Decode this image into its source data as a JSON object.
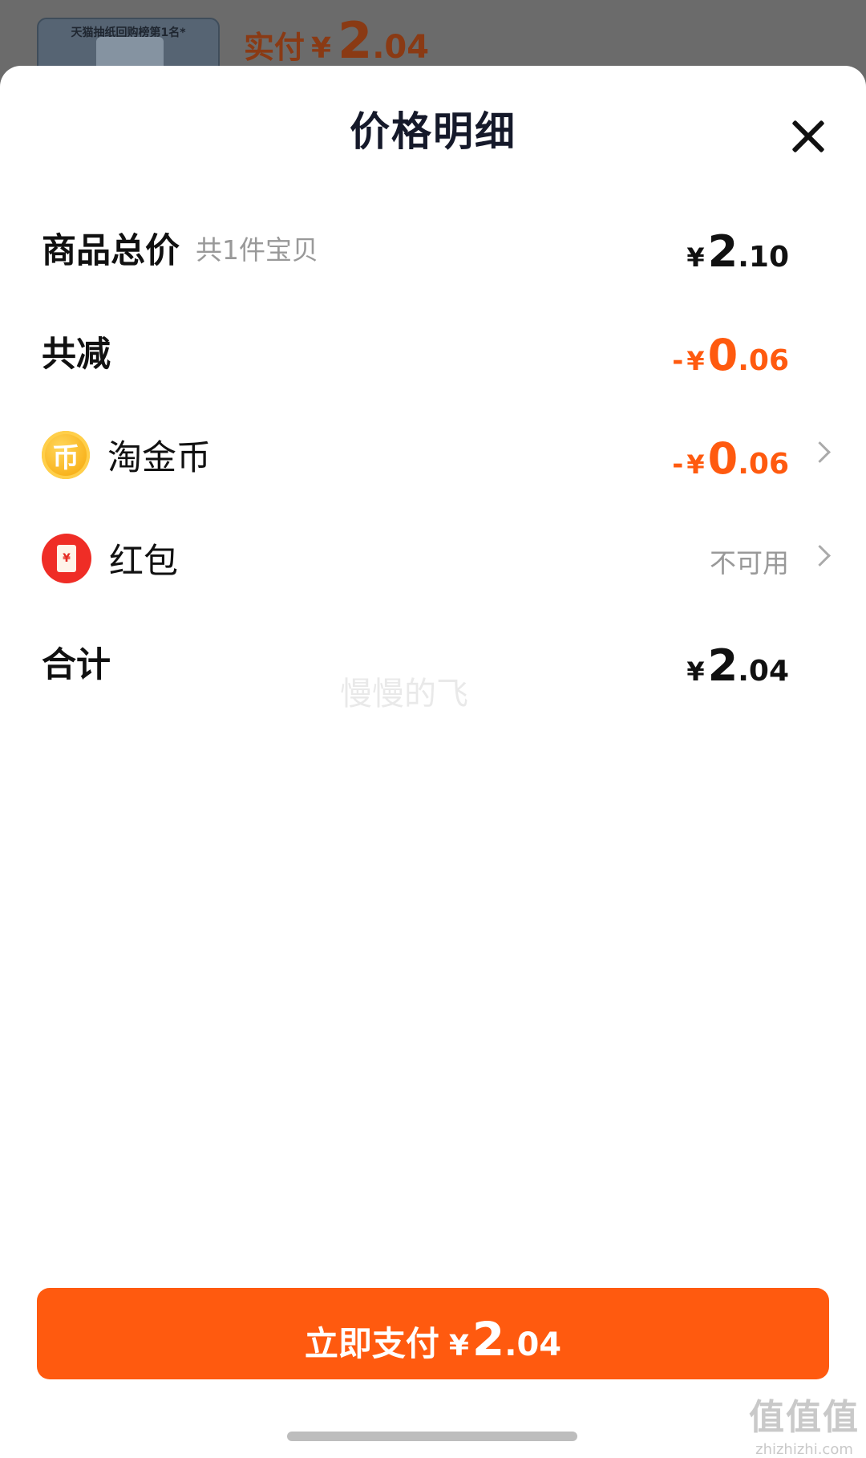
{
  "background": {
    "product_caption": "天猫抽纸回购榜第1名*",
    "paid_label": "实付",
    "paid_currency": "¥",
    "paid_int": "2",
    "paid_dec": ".04"
  },
  "sheet": {
    "title": "价格明细",
    "close_icon": "close-icon"
  },
  "rows": {
    "subtotal": {
      "label": "商品总价",
      "sub_label": "共1件宝贝",
      "currency": "¥",
      "int": "2",
      "dec": ".10"
    },
    "discount": {
      "label": "共减",
      "minus": "-",
      "currency": "¥",
      "int": "0",
      "dec": ".06"
    },
    "coins": {
      "icon": "taojinbi-coin-icon",
      "icon_glyph": "币",
      "label": "淘金币",
      "minus": "-",
      "currency": "¥",
      "int": "0",
      "dec": ".06"
    },
    "red_packet": {
      "icon": "red-packet-icon",
      "icon_glyph": "¥",
      "label": "红包",
      "status": "不可用"
    },
    "total": {
      "label": "合计",
      "currency": "¥",
      "int": "2",
      "dec": ".04"
    }
  },
  "watermark": "慢慢的飞",
  "pay_button": {
    "label": "立即支付",
    "currency": "¥",
    "int": "2",
    "dec": ".04"
  },
  "corner_mark": {
    "glyphs": "值值值",
    "site": "zhizhizhi.com"
  },
  "colors": {
    "accent": "#ff5a0f",
    "text": "#111111",
    "muted": "#999999"
  }
}
